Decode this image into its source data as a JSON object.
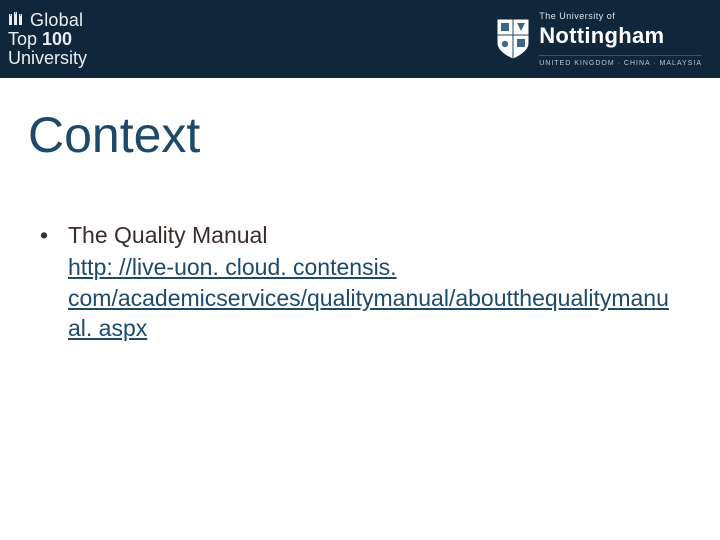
{
  "header": {
    "ranking_line1": "Global",
    "ranking_line2_prefix": "Top ",
    "ranking_line2_num": "100",
    "ranking_line3": "University",
    "uni_small": "The University of",
    "uni_name": "Nottingham",
    "uni_sub": "UNITED KINGDOM · CHINA · MALAYSIA"
  },
  "title": "Context",
  "bullet": {
    "marker": "•",
    "text": "The Quality Manual",
    "link": "http: //live-uon. cloud. contensis. com/academicservices/qualitymanual/aboutthequalitymanual. aspx"
  }
}
